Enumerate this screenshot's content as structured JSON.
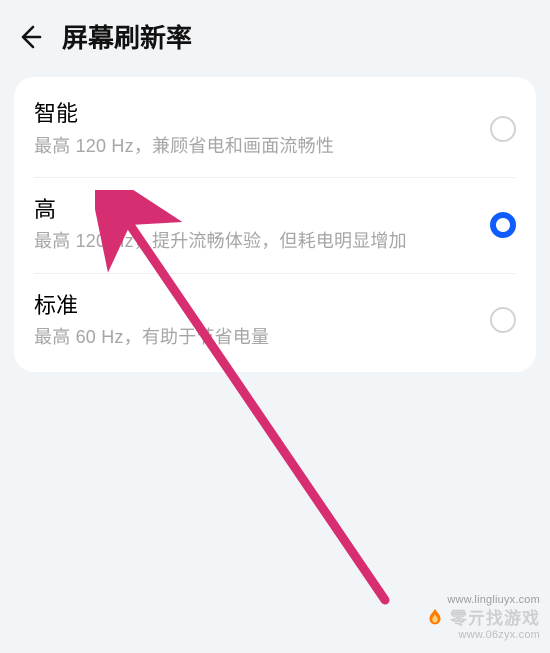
{
  "header": {
    "title": "屏幕刷新率"
  },
  "options": [
    {
      "title": "智能",
      "description": "最高 120 Hz，兼顾省电和画面流畅性",
      "selected": false
    },
    {
      "title": "高",
      "description": "最高 120 Hz，提升流畅体验，但耗电明显增加",
      "selected": true
    },
    {
      "title": "标准",
      "description": "最高 60 Hz，有助于节省电量",
      "selected": false
    }
  ],
  "annotation": {
    "arrow_color": "#d72e72"
  },
  "watermark": {
    "url_top": "www.lingliuyx.com",
    "brand_text": "零亓找游戏",
    "url_bottom": "www.06zyx.com",
    "accent_color": "#ff7a00"
  }
}
